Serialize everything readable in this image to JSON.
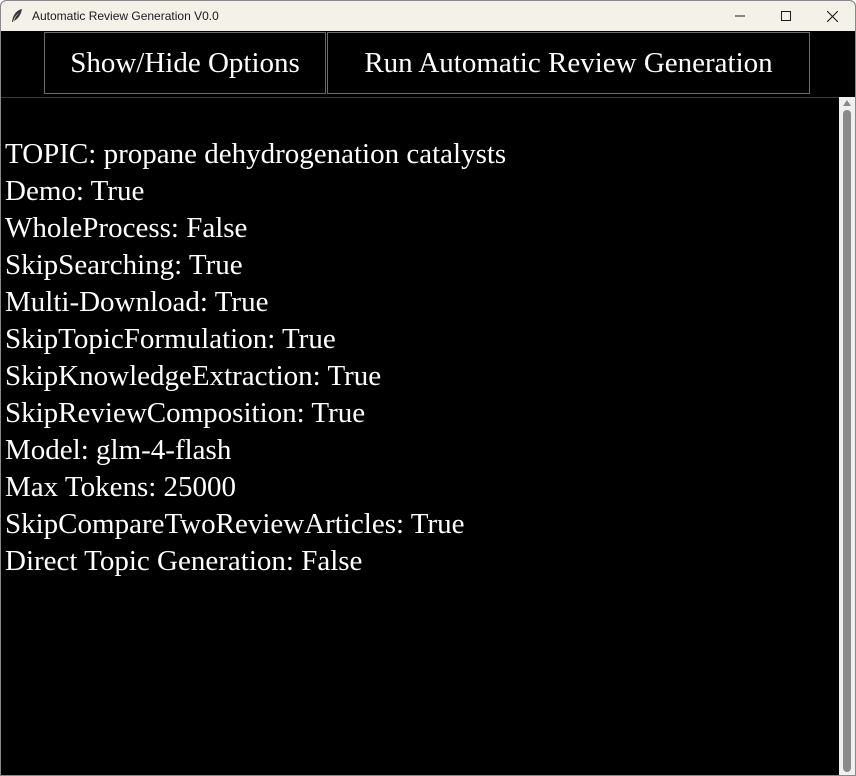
{
  "window": {
    "title": "Automatic Review Generation V0.0",
    "icons": {
      "app": "feather-icon",
      "minimize": "minimize-icon",
      "maximize": "maximize-icon",
      "close": "close-icon"
    }
  },
  "toolbar": {
    "toggle_label": "Show/Hide Options",
    "run_label": "Run Automatic Review Generation"
  },
  "output": {
    "lines": [
      "TOPIC: propane dehydrogenation catalysts",
      "Demo: True",
      "WholeProcess: False",
      "SkipSearching: True",
      "Multi-Download: True",
      "SkipTopicFormulation: True",
      "SkipKnowledgeExtraction: True",
      "SkipReviewComposition: True",
      "Model: glm-4-flash",
      "Max Tokens: 25000",
      "SkipCompareTwoReviewArticles: True",
      "Direct Topic Generation: False"
    ]
  },
  "colors": {
    "titlebar_bg": "#f3f1e8",
    "content_bg": "#000000",
    "text": "#ffffff",
    "button_border": "#6b6b6b"
  }
}
